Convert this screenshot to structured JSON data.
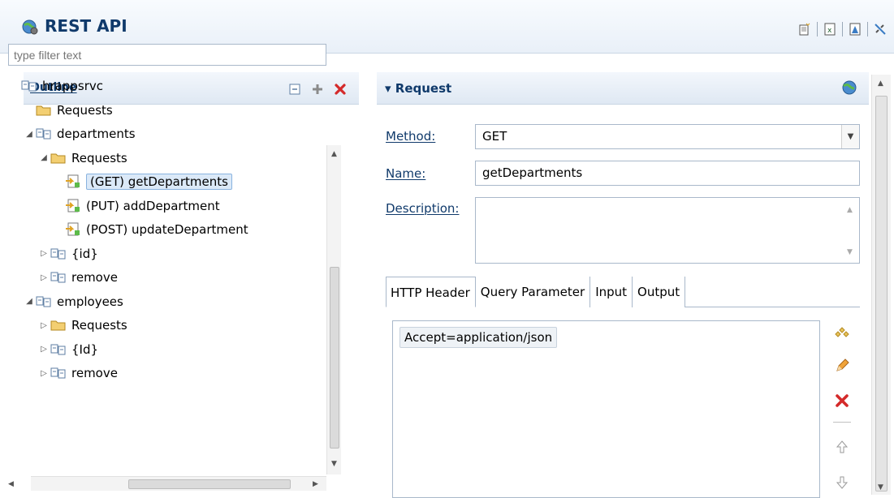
{
  "header": {
    "title": "REST API",
    "icons": [
      "new-file-icon",
      "excel-icon",
      "test-icon",
      "disconnect-icon"
    ]
  },
  "outline": {
    "title": "Outline",
    "filter_placeholder": "type filter text",
    "tools": [
      "collapse-all-icon",
      "add-icon",
      "delete-icon"
    ],
    "tree": [
      {
        "label": "hrappsrvc",
        "depth": 0,
        "expander": "none",
        "icon": "resource-icon"
      },
      {
        "label": "Requests",
        "depth": 1,
        "expander": "none",
        "icon": "folder-icon"
      },
      {
        "label": "departments",
        "depth": 1,
        "expander": "expanded",
        "icon": "resource-icon"
      },
      {
        "label": "Requests",
        "depth": 2,
        "expander": "expanded",
        "icon": "folder-icon"
      },
      {
        "label": "(GET) getDepartments",
        "depth": 3,
        "expander": "none",
        "icon": "request-icon",
        "selected": true
      },
      {
        "label": "(PUT) addDepartment",
        "depth": 3,
        "expander": "none",
        "icon": "request-icon"
      },
      {
        "label": "(POST) updateDepartment",
        "depth": 3,
        "expander": "none",
        "icon": "request-icon"
      },
      {
        "label": "{id}",
        "depth": 2,
        "expander": "collapsed",
        "icon": "resource-icon"
      },
      {
        "label": "remove",
        "depth": 2,
        "expander": "collapsed",
        "icon": "resource-icon"
      },
      {
        "label": "employees",
        "depth": 1,
        "expander": "expanded",
        "icon": "resource-icon"
      },
      {
        "label": "Requests",
        "depth": 2,
        "expander": "collapsed",
        "icon": "folder-icon"
      },
      {
        "label": "{Id}",
        "depth": 2,
        "expander": "collapsed",
        "icon": "resource-icon"
      },
      {
        "label": "remove",
        "depth": 2,
        "expander": "collapsed",
        "icon": "resource-icon"
      }
    ]
  },
  "request": {
    "section_title": "Request",
    "method_label": "Method:",
    "method_value": "GET",
    "name_label": "Name:",
    "name_value": "getDepartments",
    "description_label": "Description:",
    "description_value": "",
    "tabs": [
      "HTTP Header",
      "Query Parameter",
      "Input",
      "Output"
    ],
    "active_tab": "HTTP Header",
    "headers": [
      "Accept=application/json"
    ],
    "side_tools": [
      "add-header-icon",
      "edit-icon",
      "delete-icon",
      "move-up-icon",
      "move-down-icon"
    ]
  },
  "colors": {
    "title": "#103a6b",
    "delete": "#d42a2a",
    "folder": "#e8b64a",
    "selection": "#dbe9f8"
  }
}
